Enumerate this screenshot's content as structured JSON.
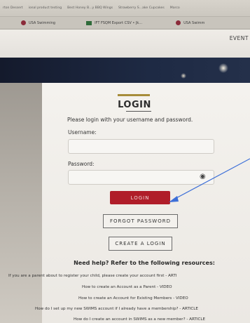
{
  "bookmarks": [
    "rton Dessert",
    "ional product testing",
    "Best Honey B...y BBQ Wings",
    "Strawberry S...ake Cupcakes",
    "Marco"
  ],
  "tabs": [
    {
      "label": "USA Swimming",
      "icon": "usa-swimming-icon"
    },
    {
      "label": "IFT FSQM Export CSV • Jk...",
      "icon": "spreadsheet-icon"
    },
    {
      "label": "USA Swimm",
      "icon": "usa-swimming-icon"
    }
  ],
  "nav": {
    "events": "EVENT"
  },
  "login": {
    "title": "LOGIN",
    "instructions": "Please login with your username and password.",
    "username_label": "Username:",
    "password_label": "Password:",
    "login_button": "LOGIN",
    "forgot_button": "FORGOT PASSWORD",
    "create_button": "CREATE A LOGIN"
  },
  "help": {
    "heading": "Need help? Refer to the following resources:",
    "resources": [
      "If you are a parent about to register your child, please create your account first - ARTI",
      "How to create an Account as a Parent - VIDEO",
      "How to create an Account for Existing Members - VIDEO",
      "How do I set up my new SWIMS account if I already have a membership? - ARTICLE",
      "How do I create an account in SWIMS as a new member? - ARTICLE"
    ]
  },
  "colors": {
    "login_red": "#b01d29",
    "gold_accent": "#a78d3a",
    "annotation_arrow": "#3d6fd8"
  }
}
